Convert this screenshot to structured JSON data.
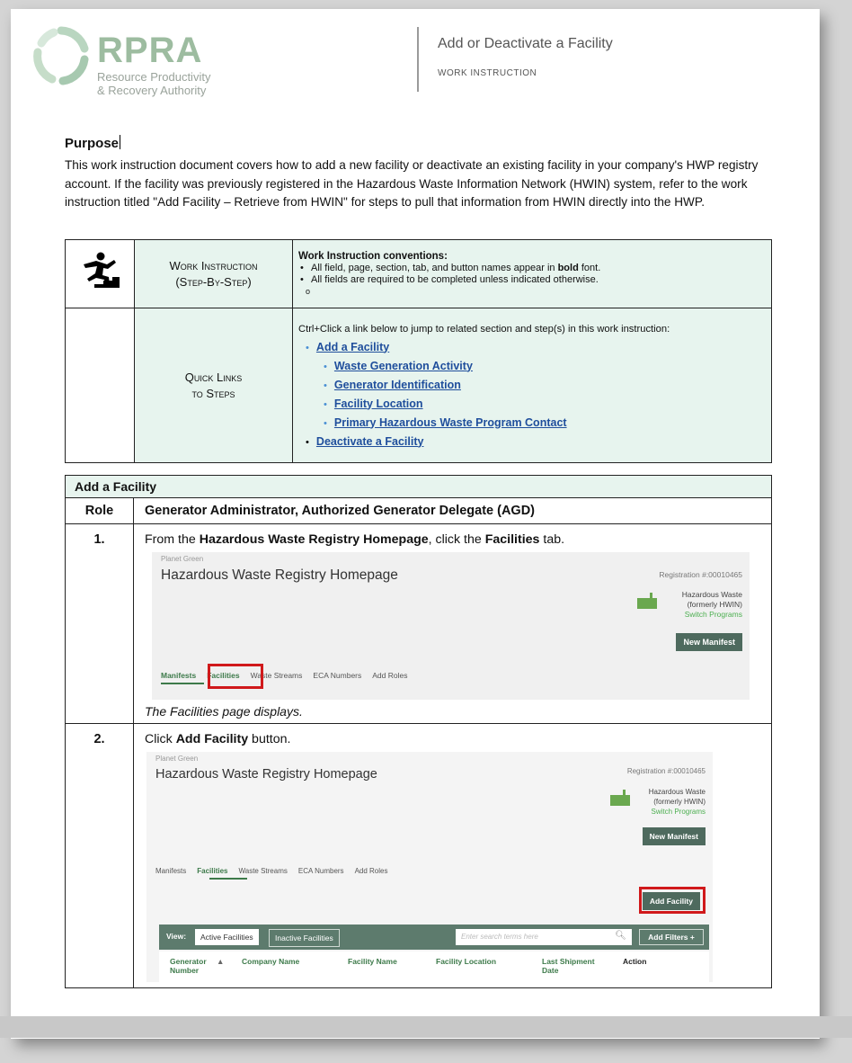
{
  "header": {
    "logo_name": "RPRA",
    "logo_line1": "Resource Productivity",
    "logo_line2": "& Recovery Authority",
    "doc_title": "Add or Deactivate a Facility",
    "doc_type": "WORK INSTRUCTION"
  },
  "purpose": {
    "heading": "Purpose",
    "paragraph": "This work instruction document covers how to add a new facility or deactivate an existing facility in your company's HWP registry account. If the facility was previously registered in the Hazardous Waste Information Network (HWIN) system, refer to the work instruction titled \"Add Facility – Retrieve from HWIN\" for steps to pull that information from HWIN directly into the HWP."
  },
  "conventions": {
    "label_line1": "Work Instruction",
    "label_line2": "(Step-By-Step)",
    "heading": "Work Instruction conventions:",
    "bullet1_pre": "All field, page, section, tab, and button names appear in ",
    "bullet1_bold": "bold",
    "bullet1_post": " font.",
    "bullet2": "All fields are required to be completed unless indicated otherwise.",
    "bullet3": ""
  },
  "quick_links": {
    "label_line1": "Quick Links",
    "label_line2": "to Steps",
    "intro": "Ctrl+Click a link below to jump to related section and step(s) in this work instruction:",
    "add_facility": "Add a Facility",
    "sub_links": [
      "Waste Generation Activity",
      "Generator Identification",
      "Facility Location",
      "Primary Hazardous Waste Program Contact"
    ],
    "deactivate": "Deactivate a Facility"
  },
  "steps_table": {
    "section_title": "Add a Facility",
    "role_header": "Role",
    "role_text": "Generator Administrator, Authorized Generator Delegate (AGD)",
    "step1": {
      "number": "1.",
      "pre": "From the ",
      "b1": "Hazardous Waste Registry Homepage",
      "mid": ", click the ",
      "b2": "Facilities",
      "post": " tab.",
      "after": "The Facilities page displays."
    },
    "step2": {
      "number": "2.",
      "pre": "Click ",
      "b1": "Add Facility",
      "post": " button."
    }
  },
  "mock_screen": {
    "org": "Planet Green",
    "title": "Hazardous Waste Registry Homepage",
    "registration": "Registration #:00010465",
    "program_line1": "Hazardous Waste",
    "program_line2": "(formerly HWIN)",
    "switch_programs": "Switch Programs",
    "new_manifest": "New Manifest",
    "tabs": [
      "Manifests",
      "Facilities",
      "Waste Streams",
      "ECA Numbers",
      "Add Roles"
    ],
    "add_facility_btn": "Add Facility",
    "view_label": "View:",
    "active_facilities": "Active Facilities",
    "inactive_facilities": "Inactive Facilities",
    "search_placeholder": "Enter search terms here",
    "add_filters": "Add Filters  +",
    "columns": [
      "Generator Number",
      "Company Name",
      "Facility Name",
      "Facility Location",
      "Last Shipment Date",
      "Action"
    ]
  },
  "colors": {
    "accent_green": "#3d7a4a",
    "table_tint": "#e7f4ee",
    "link_blue": "#1f4e9c",
    "highlight_red": "#d0191b"
  }
}
